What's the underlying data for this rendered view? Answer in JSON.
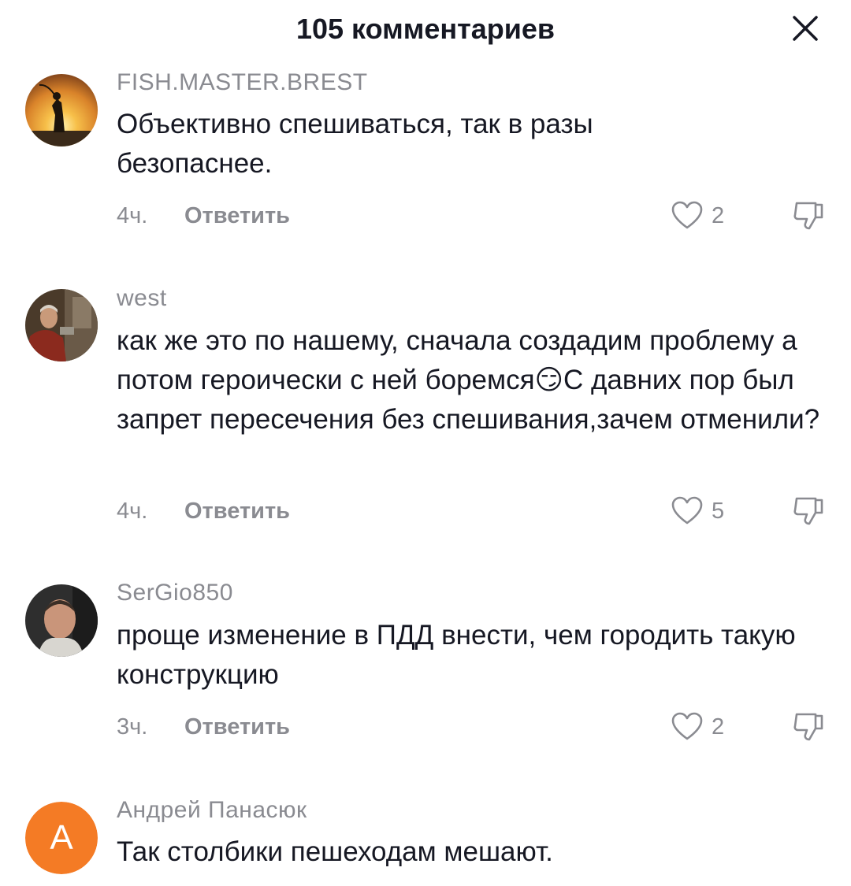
{
  "header": {
    "title": "105 комментариев",
    "close_icon": "close-icon"
  },
  "comments": [
    {
      "username": "FISH.MASTER.BREST",
      "text": "Объективно спешиваться, так в разы безопаснее.",
      "time": "4ч.",
      "reply_label": "Ответить",
      "likes": "2"
    },
    {
      "username": "west",
      "text": "как же это по нашему, сначала создадим проблему а потом героически с ней боремся😏С давних пор был запрет пересечения без спешивания,зачем отменили?",
      "time": "4ч.",
      "reply_label": "Ответить",
      "likes": "5"
    },
    {
      "username": "SerGio850",
      "text": "проще изменение в ПДД внести, чем городить такую конструкцию",
      "time": "3ч.",
      "reply_label": "Ответить",
      "likes": "2"
    },
    {
      "username": "Андрей Панасюк",
      "avatar_letter": "А",
      "text": "Так столбики пешеходам мешают."
    }
  ],
  "colors": {
    "text": "#161823",
    "secondary": "#8a8b91",
    "avatar_orange": "#f47b25"
  }
}
